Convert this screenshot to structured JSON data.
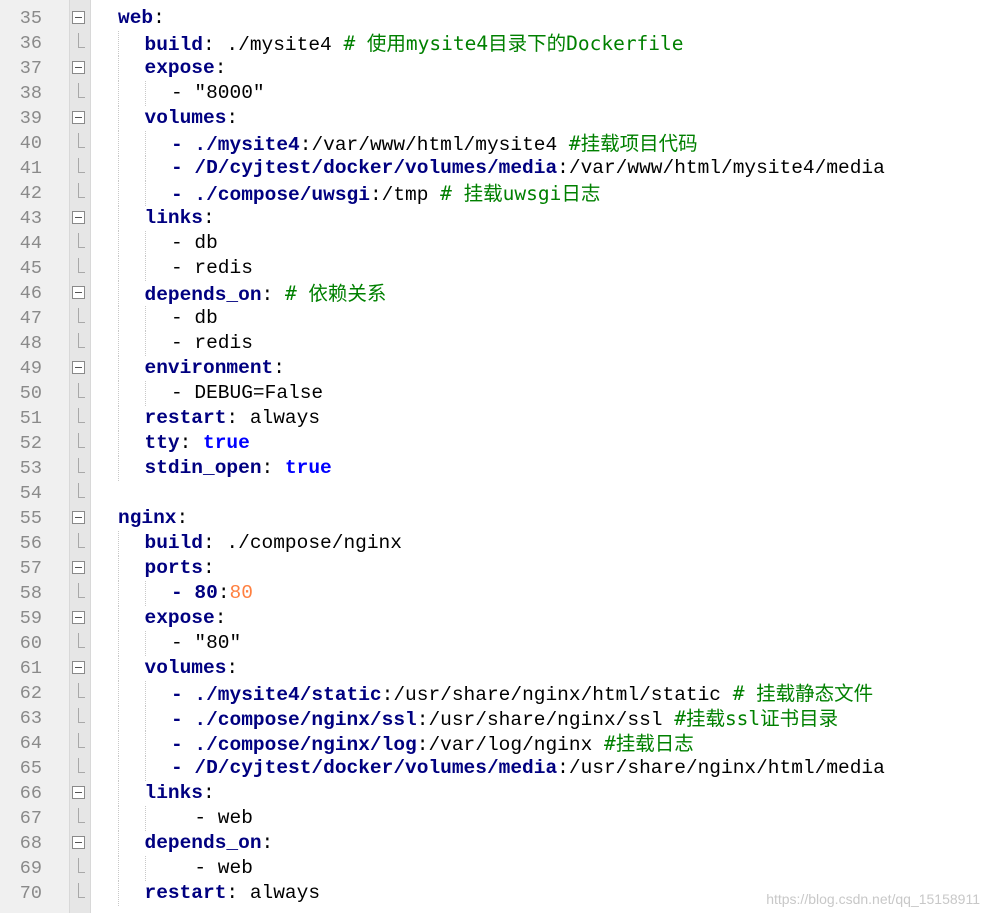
{
  "editor": {
    "lines": [
      {
        "n": "35",
        "fold": "box",
        "indent": 0,
        "tokens": [
          [
            "key",
            "web"
          ],
          [
            "sep",
            ":"
          ]
        ]
      },
      {
        "n": "36",
        "fold": "tick",
        "indent": 1,
        "tokens": [
          [
            "key",
            "build"
          ],
          [
            "sep",
            ":"
          ],
          [
            "plain",
            " ./mysite4 "
          ],
          [
            "cmt",
            "# 使用mysite4目录下的Dockerfile"
          ]
        ]
      },
      {
        "n": "37",
        "fold": "box",
        "indent": 1,
        "tokens": [
          [
            "key",
            "expose"
          ],
          [
            "sep",
            ":"
          ]
        ]
      },
      {
        "n": "38",
        "fold": "tick",
        "indent": 2,
        "tokens": [
          [
            "plain",
            "- \"8000\""
          ]
        ]
      },
      {
        "n": "39",
        "fold": "box",
        "indent": 1,
        "tokens": [
          [
            "key",
            "volumes"
          ],
          [
            "sep",
            ":"
          ]
        ]
      },
      {
        "n": "40",
        "fold": "tick",
        "indent": 2,
        "tokens": [
          [
            "key",
            "- ./mysite4"
          ],
          [
            "sep",
            ":"
          ],
          [
            "plain",
            "/var/www/html/mysite4 "
          ],
          [
            "cmt",
            "#挂载项目代码"
          ]
        ]
      },
      {
        "n": "41",
        "fold": "tick",
        "indent": 2,
        "tokens": [
          [
            "key",
            "- /D/cyjtest/docker/volumes/media"
          ],
          [
            "sep",
            ":"
          ],
          [
            "plain",
            "/var/www/html/mysite4/media"
          ]
        ]
      },
      {
        "n": "42",
        "fold": "tick",
        "indent": 2,
        "tokens": [
          [
            "key",
            "- ./compose/uwsgi"
          ],
          [
            "sep",
            ":"
          ],
          [
            "plain",
            "/tmp "
          ],
          [
            "cmt",
            "# 挂载uwsgi日志"
          ]
        ]
      },
      {
        "n": "43",
        "fold": "box",
        "indent": 1,
        "tokens": [
          [
            "key",
            "links"
          ],
          [
            "sep",
            ":"
          ]
        ]
      },
      {
        "n": "44",
        "fold": "tick",
        "indent": 2,
        "tokens": [
          [
            "plain",
            "- db"
          ]
        ]
      },
      {
        "n": "45",
        "fold": "tick",
        "indent": 2,
        "tokens": [
          [
            "plain",
            "- redis"
          ]
        ]
      },
      {
        "n": "46",
        "fold": "box",
        "indent": 1,
        "tokens": [
          [
            "key",
            "depends_on"
          ],
          [
            "sep",
            ": "
          ],
          [
            "cmt",
            "# 依赖关系"
          ]
        ]
      },
      {
        "n": "47",
        "fold": "tick",
        "indent": 2,
        "tokens": [
          [
            "plain",
            "- db"
          ]
        ]
      },
      {
        "n": "48",
        "fold": "tick",
        "indent": 2,
        "tokens": [
          [
            "plain",
            "- redis"
          ]
        ]
      },
      {
        "n": "49",
        "fold": "box",
        "indent": 1,
        "tokens": [
          [
            "key",
            "environment"
          ],
          [
            "sep",
            ":"
          ]
        ]
      },
      {
        "n": "50",
        "fold": "tick",
        "indent": 2,
        "tokens": [
          [
            "plain",
            "- DEBUG=False"
          ]
        ]
      },
      {
        "n": "51",
        "fold": "tick",
        "indent": 1,
        "tokens": [
          [
            "key",
            "restart"
          ],
          [
            "sep",
            ":"
          ],
          [
            "plain",
            " always"
          ]
        ]
      },
      {
        "n": "52",
        "fold": "tick",
        "indent": 1,
        "tokens": [
          [
            "key",
            "tty"
          ],
          [
            "sep",
            ": "
          ],
          [
            "kw",
            "true"
          ]
        ]
      },
      {
        "n": "53",
        "fold": "tick",
        "indent": 1,
        "tokens": [
          [
            "key",
            "stdin_open"
          ],
          [
            "sep",
            ": "
          ],
          [
            "kw",
            "true"
          ]
        ]
      },
      {
        "n": "54",
        "fold": "tick",
        "indent": 0,
        "tokens": []
      },
      {
        "n": "55",
        "fold": "box",
        "indent": 0,
        "tokens": [
          [
            "key",
            "nginx"
          ],
          [
            "sep",
            ":"
          ]
        ]
      },
      {
        "n": "56",
        "fold": "tick",
        "indent": 1,
        "tokens": [
          [
            "key",
            "build"
          ],
          [
            "sep",
            ":"
          ],
          [
            "plain",
            " ./compose/nginx"
          ]
        ]
      },
      {
        "n": "57",
        "fold": "box",
        "indent": 1,
        "tokens": [
          [
            "key",
            "ports"
          ],
          [
            "sep",
            ":"
          ]
        ]
      },
      {
        "n": "58",
        "fold": "tick",
        "indent": 2,
        "tokens": [
          [
            "key",
            "- 80"
          ],
          [
            "sep",
            ":"
          ],
          [
            "num",
            "80"
          ]
        ]
      },
      {
        "n": "59",
        "fold": "box",
        "indent": 1,
        "tokens": [
          [
            "key",
            "expose"
          ],
          [
            "sep",
            ":"
          ]
        ]
      },
      {
        "n": "60",
        "fold": "tick",
        "indent": 2,
        "tokens": [
          [
            "plain",
            "- \"80\""
          ]
        ]
      },
      {
        "n": "61",
        "fold": "box",
        "indent": 1,
        "tokens": [
          [
            "key",
            "volumes"
          ],
          [
            "sep",
            ":"
          ]
        ]
      },
      {
        "n": "62",
        "fold": "tick",
        "indent": 2,
        "tokens": [
          [
            "key",
            "- ./mysite4/static"
          ],
          [
            "sep",
            ":"
          ],
          [
            "plain",
            "/usr/share/nginx/html/static "
          ],
          [
            "cmt",
            "# 挂载静态文件"
          ]
        ]
      },
      {
        "n": "63",
        "fold": "tick",
        "indent": 2,
        "tokens": [
          [
            "key",
            "- ./compose/nginx/ssl"
          ],
          [
            "sep",
            ":"
          ],
          [
            "plain",
            "/usr/share/nginx/ssl "
          ],
          [
            "cmt",
            "#挂载ssl证书目录"
          ]
        ]
      },
      {
        "n": "64",
        "fold": "tick",
        "indent": 2,
        "tokens": [
          [
            "key",
            "- ./compose/nginx/log"
          ],
          [
            "sep",
            ":"
          ],
          [
            "plain",
            "/var/log/nginx "
          ],
          [
            "cmt",
            "#挂载日志"
          ]
        ]
      },
      {
        "n": "65",
        "fold": "tick",
        "indent": 2,
        "tokens": [
          [
            "key",
            "- /D/cyjtest/docker/volumes/media"
          ],
          [
            "sep",
            ":"
          ],
          [
            "plain",
            "/usr/share/nginx/html/media"
          ]
        ]
      },
      {
        "n": "66",
        "fold": "box",
        "indent": 1,
        "tokens": [
          [
            "key",
            "links"
          ],
          [
            "sep",
            ":"
          ]
        ]
      },
      {
        "n": "67",
        "fold": "tick",
        "indent": 2,
        "tokens": [
          [
            "plain",
            "  - web"
          ]
        ]
      },
      {
        "n": "68",
        "fold": "box",
        "indent": 1,
        "tokens": [
          [
            "key",
            "depends_on"
          ],
          [
            "sep",
            ":"
          ]
        ]
      },
      {
        "n": "69",
        "fold": "tick",
        "indent": 2,
        "tokens": [
          [
            "plain",
            "  - web"
          ]
        ]
      },
      {
        "n": "70",
        "fold": "tick",
        "indent": 1,
        "tokens": [
          [
            "key",
            "restart"
          ],
          [
            "sep",
            ":"
          ],
          [
            "plain",
            " always"
          ]
        ]
      }
    ]
  },
  "watermark": "https://blog.csdn.net/qq_15158911"
}
